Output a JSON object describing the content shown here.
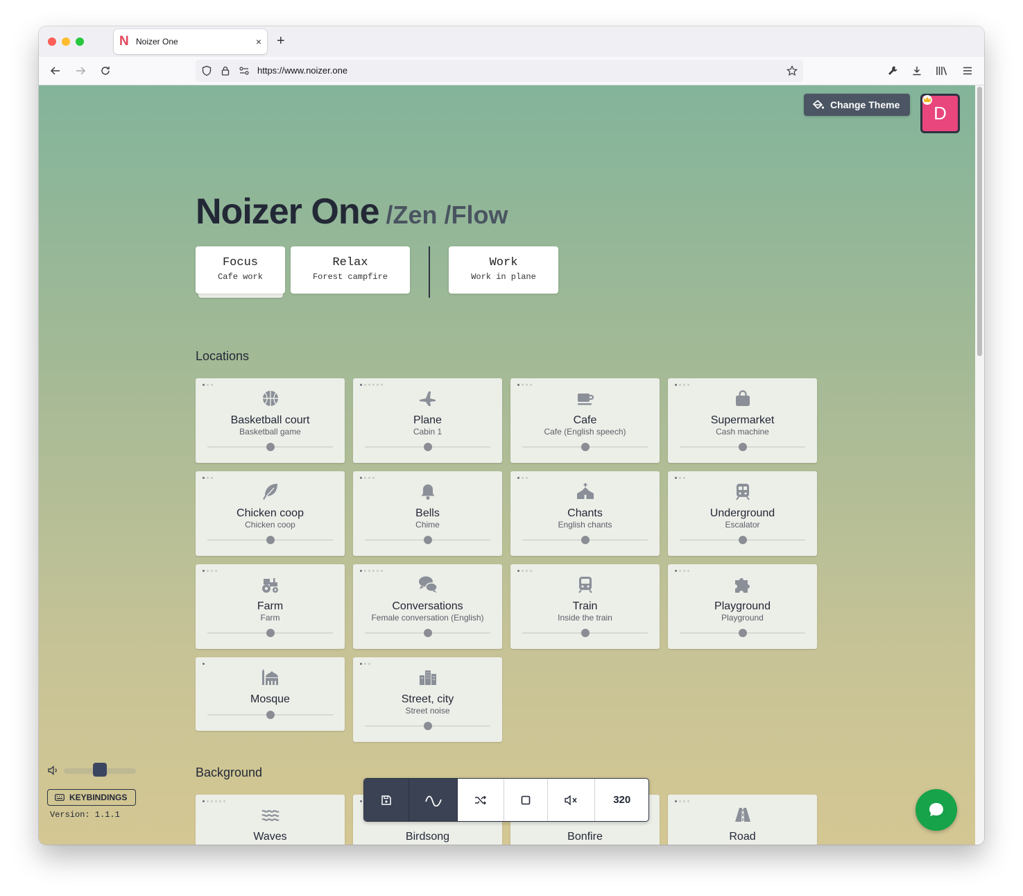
{
  "browser": {
    "tab_title": "Noizer One",
    "url_host": "https://www.noizer.one",
    "new_tab_label": "+",
    "close_tab_label": "×"
  },
  "header": {
    "change_theme_label": "Change Theme",
    "avatar_letter": "D"
  },
  "hero": {
    "title": "Noizer One",
    "subtitle": "/Zen /Flow"
  },
  "presets": [
    {
      "name": "Focus",
      "sub": "Cafe work"
    },
    {
      "name": "Relax",
      "sub": "Forest campfire"
    },
    {
      "name": "Work",
      "sub": "Work in plane"
    }
  ],
  "sections": {
    "locations": "Locations",
    "background": "Background"
  },
  "locations": [
    {
      "name": "Basketball court",
      "sub": "Basketball game",
      "icon": "basketball-icon",
      "dots": 3,
      "active_dot": 1
    },
    {
      "name": "Plane",
      "sub": "Cabin 1",
      "icon": "plane-icon",
      "dots": 6,
      "active_dot": 1
    },
    {
      "name": "Cafe",
      "sub": "Cafe (English speech)",
      "icon": "coffee-cup-icon",
      "dots": 4,
      "active_dot": 1
    },
    {
      "name": "Supermarket",
      "sub": "Cash machine",
      "icon": "shopping-bag-icon",
      "dots": 4,
      "active_dot": 1
    },
    {
      "name": "Chicken coop",
      "sub": "Chicken coop",
      "icon": "feather-icon",
      "dots": 3,
      "active_dot": 1
    },
    {
      "name": "Bells",
      "sub": "Chime",
      "icon": "bell-icon",
      "dots": 4,
      "active_dot": 1
    },
    {
      "name": "Chants",
      "sub": "English chants",
      "icon": "church-icon",
      "dots": 3,
      "active_dot": 1
    },
    {
      "name": "Underground",
      "sub": "Escalator",
      "icon": "subway-icon",
      "dots": 3,
      "active_dot": 1
    },
    {
      "name": "Farm",
      "sub": "Farm",
      "icon": "tractor-icon",
      "dots": 4,
      "active_dot": 1
    },
    {
      "name": "Conversations",
      "sub": "Female conversation (English)",
      "icon": "chat-bubbles-icon",
      "dots": 6,
      "active_dot": 1
    },
    {
      "name": "Train",
      "sub": "Inside the train",
      "icon": "train-icon",
      "dots": 4,
      "active_dot": 1
    },
    {
      "name": "Playground",
      "sub": "Playground",
      "icon": "puzzle-icon",
      "dots": 4,
      "active_dot": 1
    },
    {
      "name": "Mosque",
      "sub": "",
      "icon": "mosque-icon",
      "dots": 1,
      "active_dot": 1
    },
    {
      "name": "Street, city",
      "sub": "Street noise",
      "icon": "city-icon",
      "dots": 3,
      "active_dot": 1
    }
  ],
  "background": [
    {
      "name": "Waves",
      "icon": "waves-icon",
      "dots": 6
    },
    {
      "name": "Birdsong",
      "icon": "bird-icon",
      "dots": 1
    },
    {
      "name": "Bonfire",
      "icon": "fire-icon",
      "dots": 1
    },
    {
      "name": "Road",
      "icon": "road-icon",
      "dots": 4
    }
  ],
  "controls": {
    "keybindings_label": "KEYBINDINGS",
    "version": "Version: 1.1.1",
    "volume_level": 0.5
  },
  "player": {
    "count": "320"
  },
  "colors": {
    "avatar": "#e8467c",
    "player_dark": "#3a4253",
    "chat": "#16a34a"
  }
}
